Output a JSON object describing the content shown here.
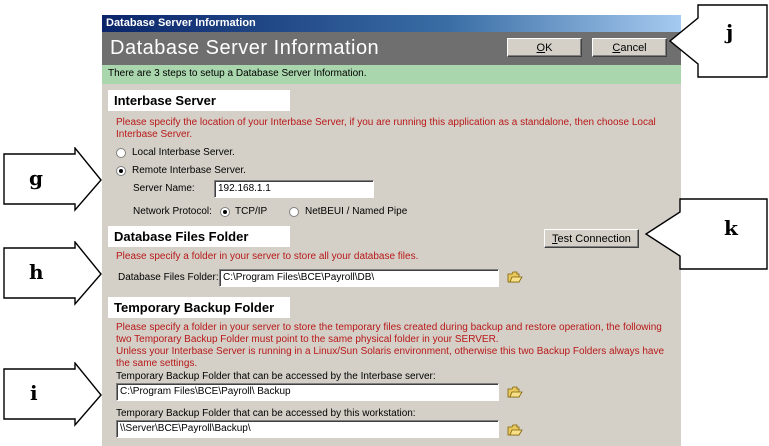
{
  "window": {
    "title": "Database Server Information"
  },
  "header": {
    "title": "Database Server Information",
    "ok_label": "OK",
    "ok_mnemonic": "O",
    "cancel_label": "Cancel",
    "cancel_mnemonic": "C"
  },
  "info": {
    "text": "There are 3 steps to setup a Database Server Information."
  },
  "interbase": {
    "heading": "Interbase Server",
    "description": "Please specify the location of your Interbase Server, if you are running this application as a standalone, then choose Local Interbase Server.",
    "local_label": "Local Interbase Server.",
    "remote_label": "Remote Interbase Server.",
    "selected": "remote",
    "server_name_label": "Server Name:",
    "server_name_value": "192.168.1.1",
    "protocol_label": "Network Protocol:",
    "protocol_tcp": "TCP/IP",
    "protocol_netbeui": "NetBEUI / Named Pipe",
    "protocol_selected": "tcp"
  },
  "dbfiles": {
    "heading": "Database Files Folder",
    "test_connection_label": "Test Connection",
    "description": "Please specify a folder in your server to store all your database files.",
    "folder_label": "Database Files Folder:",
    "folder_value": "C:\\Program Files\\BCE\\Payroll\\DB\\"
  },
  "backup": {
    "heading": "Temporary Backup Folder",
    "description_1": "Please specify a folder in your server to store the temporary files created during backup and restore operation, the following",
    "description_2": "two Temporary Backup Folder must point to the same physical folder in your SERVER.",
    "description_3": "Unless your Interbase Server is running in a Linux/Sun Solaris environment, otherwise this two Backup Folders always have",
    "description_4": "the same settings.",
    "server_folder_label": "Temporary Backup Folder that can be accessed by the Interbase server:",
    "server_folder_value": "C:\\Program Files\\BCE\\Payroll\\ Backup",
    "workstation_folder_label": "Temporary Backup Folder that can be accessed by this workstation:",
    "workstation_folder_value": "\\\\Server\\BCE\\Payroll\\Backup\\"
  },
  "callouts": {
    "g": "g",
    "h": "h",
    "i": "i",
    "j": "j",
    "k": "k"
  },
  "colors": {
    "header_bg": "#6f6f6f",
    "info_bg": "#a9d6ad",
    "description_text": "#b81818",
    "dialog_bg": "#d4d0c8"
  }
}
